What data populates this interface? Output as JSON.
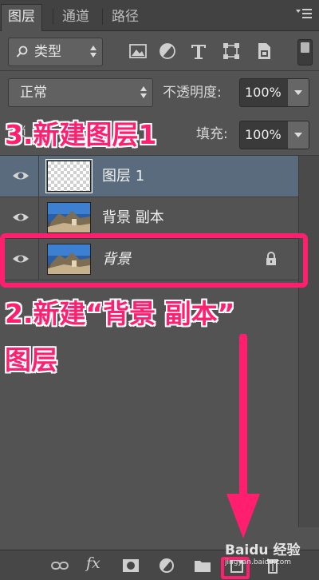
{
  "tabs": [
    {
      "label": "图层",
      "active": true
    },
    {
      "label": "通道",
      "active": false
    },
    {
      "label": "路径",
      "active": false
    }
  ],
  "filter": {
    "type_label": "类型",
    "icons": [
      "image-filter-icon",
      "adjustment-filter-icon",
      "type-filter-icon",
      "shape-filter-icon",
      "smart-object-filter-icon"
    ]
  },
  "blend": {
    "mode": "正常",
    "opacity_label": "不透明度:",
    "opacity_value": "100%",
    "fill_label": "填充:",
    "fill_value": "100%"
  },
  "layers": [
    {
      "name": "图层 1",
      "selected": true,
      "thumb": "transparent",
      "locked": false
    },
    {
      "name": "背景 副本",
      "selected": false,
      "thumb": "photo",
      "locked": false
    },
    {
      "name": "背景",
      "selected": false,
      "thumb": "photo",
      "locked": true,
      "italic": true
    }
  ],
  "bottom_toolbar": {
    "fx_label": "fx"
  },
  "annotations": {
    "step3": "3.新建图层1",
    "step2_line1": "2.新建“背景 副本”",
    "step2_line2": "图层"
  },
  "watermark": {
    "logo": "Baidu 经验",
    "url": "jingyan.baidu.com"
  },
  "colors": {
    "panel_bg": "#535353",
    "selected_row": "#5b6b7e",
    "annotation": "#ff1f6e"
  }
}
